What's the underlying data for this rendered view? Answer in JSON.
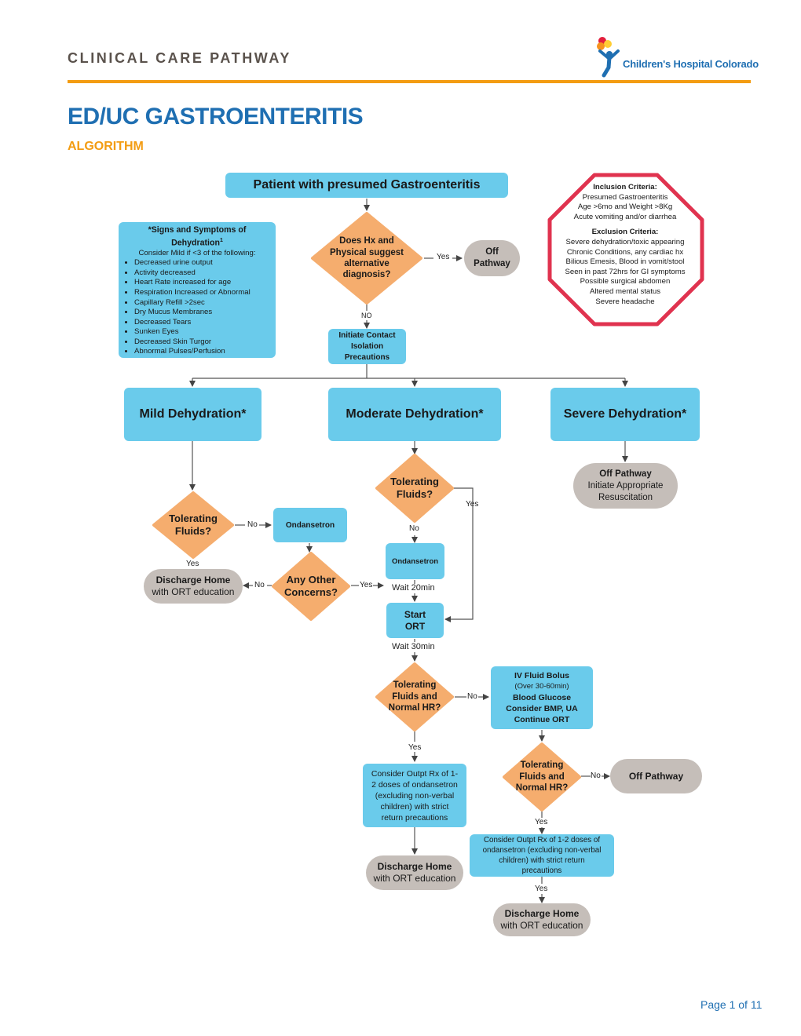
{
  "header": {
    "section_title": "CLINICAL CARE PATHWAY",
    "logo_text": "Children's Hospital Colorado",
    "logo_icon": "child-with-balloons-logo",
    "main_title": "ED/UC GASTROENTERITIS",
    "subtitle": "ALGORITHM"
  },
  "colors": {
    "brand_blue": "#1f6fb2",
    "accent_orange": "#f39c12",
    "process_box": "#6acbeb",
    "decision_diamond": "#f5ad6e",
    "terminal_pill": "#c5beb9",
    "criteria_octagon_border": "#e0334f"
  },
  "flow": {
    "start": "Patient with presumed Gastroenteritis",
    "decision_alt_dx": [
      "Does Hx and",
      "Physical suggest",
      "alternative",
      "diagnosis?"
    ],
    "yes_label": "Yes",
    "no_label_caps": "NO",
    "off_pathway_top": [
      "Off",
      "Pathway"
    ],
    "isolation": [
      "Initiate Contact",
      "Isolation",
      "Precautions"
    ],
    "mild": "Mild Dehydration*",
    "moderate": "Moderate Dehydration*",
    "severe": "Severe Dehydration*"
  },
  "signs_box": {
    "title_line1": "*Signs and Symptoms of",
    "title_line2": "Dehydration",
    "superscript": "1",
    "subtitle": "Consider Mild if <3 of the following:",
    "items": [
      "Decreased urine output",
      "Activity decreased",
      "Heart Rate increased for age",
      "Respiration Increased or Abnormal",
      "Capillary Refill >2sec",
      "Dry Mucus Membranes",
      "Decreased Tears",
      "Sunken Eyes",
      "Decreased Skin Turgor",
      "Abnormal Pulses/Perfusion"
    ]
  },
  "criteria": {
    "inclusion_title": "Inclusion Criteria:",
    "inclusion": [
      "Presumed Gastroenteritis",
      "Age >6mo and Weight >8Kg",
      "Acute vomiting and/or diarrhea"
    ],
    "exclusion_title": "Exclusion Criteria:",
    "exclusion": [
      "Severe dehydration/toxic appearing",
      "Chronic Conditions, any cardiac hx",
      "Bilious Emesis, Blood in vomit/stool",
      "Seen in past 72hrs for GI symptoms",
      "Possible surgical abdomen",
      "Altered mental status",
      "Severe headache"
    ]
  },
  "mild_branch": {
    "decision": [
      "Tolerating",
      "Fluids?"
    ],
    "no": "No",
    "yes": "Yes",
    "ondansetron": "Ondansetron",
    "concerns": [
      "Any Other",
      "Concerns?"
    ],
    "discharge_bold": "Discharge Home",
    "discharge_sub": "with ORT education"
  },
  "moderate_branch": {
    "decision": [
      "Tolerating",
      "Fluids?"
    ],
    "yes": "Yes",
    "no": "No",
    "ondansetron": "Ondansetron",
    "wait20": "Wait 20min",
    "start_ort": [
      "Start",
      "ORT"
    ],
    "wait30": "Wait 30min",
    "decision2": [
      "Tolerating",
      "Fluids and",
      "Normal HR?"
    ],
    "iv_box": {
      "l1": "IV Fluid Bolus",
      "l2": "(Over 30-60min)",
      "l3": "Blood Glucose",
      "l4": "Consider BMP, UA",
      "l5": "Continue ORT"
    },
    "rx_left": [
      "Consider Outpt Rx of 1-",
      "2 doses of ondansetron",
      "(excluding non-verbal",
      "children) with strict",
      "return precautions"
    ],
    "discharge_left_bold": "Discharge Home",
    "discharge_left_sub": "with ORT education",
    "decision3": [
      "Tolerating",
      "Fluids and",
      "Normal HR?"
    ],
    "off_pathway": "Off Pathway",
    "rx_right": [
      "Consider Outpt Rx of 1-2 doses of",
      "ondansetron (excluding non-verbal",
      "children) with strict return",
      "precautions"
    ],
    "discharge_right_bold": "Discharge Home",
    "discharge_right_sub": "with ORT education"
  },
  "severe_branch": {
    "bold": "Off Pathway",
    "l2": "Initiate Appropriate",
    "l3": "Resuscitation"
  },
  "footer": {
    "page": "Page 1 of 11"
  }
}
